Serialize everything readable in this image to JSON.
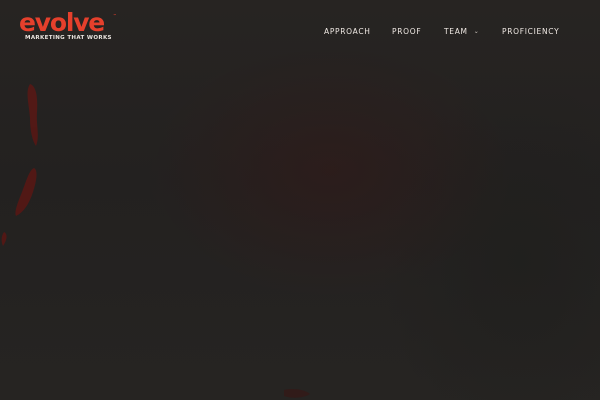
{
  "brand": {
    "name": "evolve",
    "trademark": "™",
    "tagline": "MARKETING THAT WORKS",
    "color": "#e5402c"
  },
  "nav": {
    "items": [
      {
        "label": "APPROACH"
      },
      {
        "label": "PROOF"
      },
      {
        "label": "TEAM",
        "dropdown_icon": "chevron-down-icon",
        "chevron": "⌄"
      },
      {
        "label": "PROFICIENCY"
      }
    ]
  },
  "theme": {
    "background": "#252320",
    "nav_text": "#efe9e4",
    "accent": "#e5402c",
    "hero_stroke": "#6a1a16"
  }
}
